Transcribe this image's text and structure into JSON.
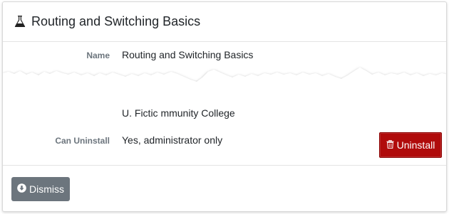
{
  "header": {
    "title": "Routing and Switching Basics",
    "icon": "flask-icon"
  },
  "details": {
    "name_label": "Name",
    "name_value": "Routing and Switching Basics",
    "partial_value": "U. Fictic        mmunity College",
    "can_uninstall_label": "Can Uninstall",
    "can_uninstall_value": "Yes, administrator only"
  },
  "actions": {
    "uninstall_label": "Uninstall",
    "uninstall_icon": "trash-icon",
    "dismiss_label": "Dismiss",
    "dismiss_icon": "arrow-circle-down-icon"
  },
  "colors": {
    "uninstall_bg": "#b00b0b",
    "dismiss_bg": "#6c757d"
  }
}
